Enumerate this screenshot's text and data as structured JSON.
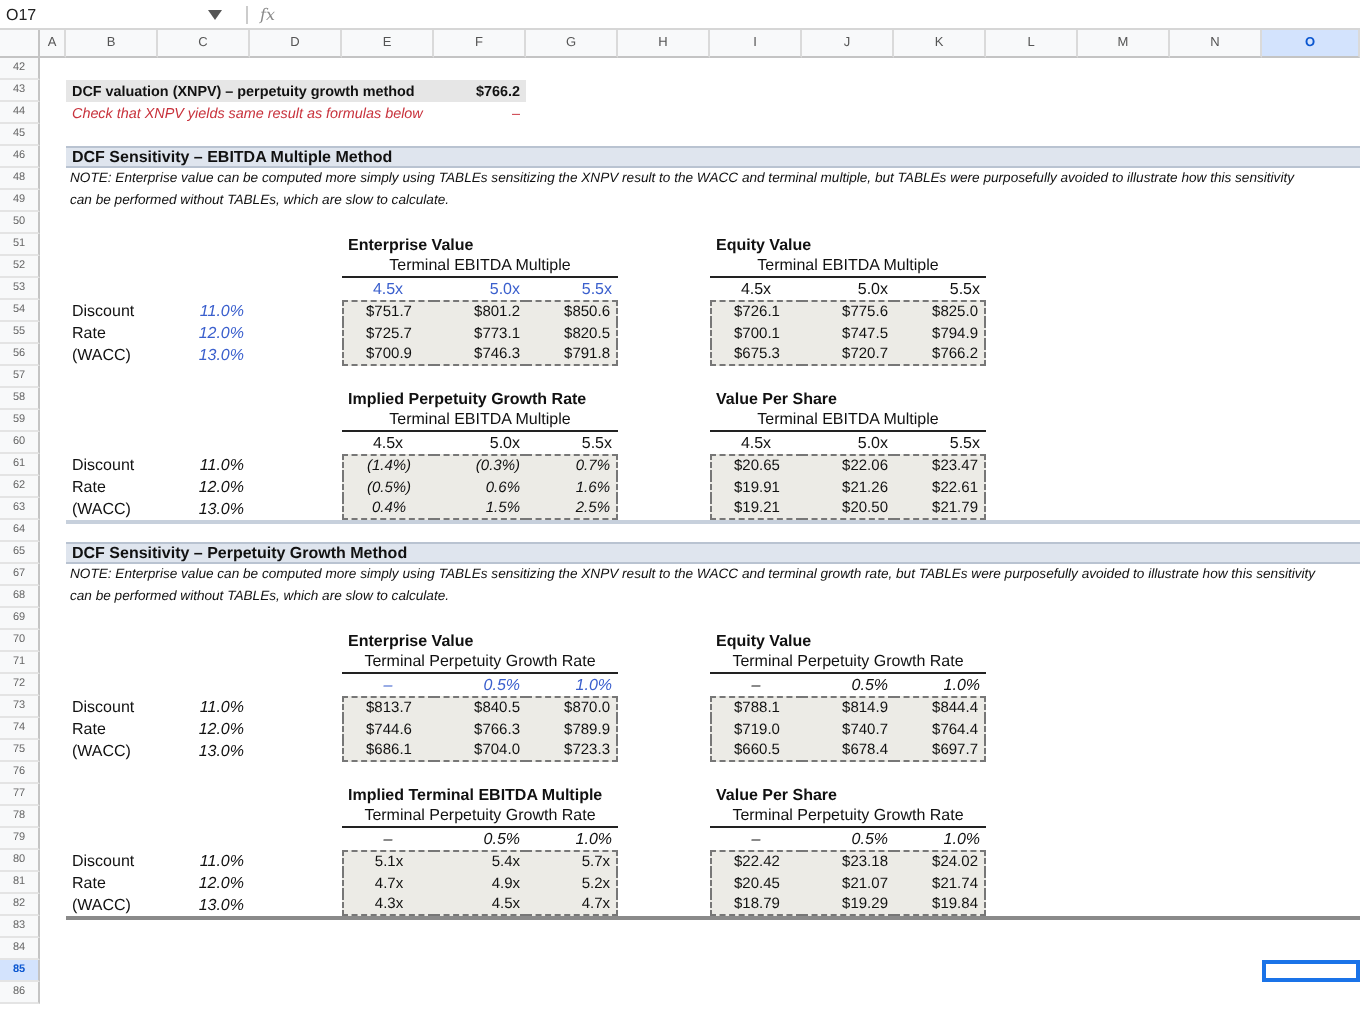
{
  "name_box": "O17",
  "formula_icon": "fx",
  "columns": [
    {
      "label": "A",
      "selected": false
    },
    {
      "label": "B",
      "selected": false
    },
    {
      "label": "C",
      "selected": false
    },
    {
      "label": "D",
      "selected": false
    },
    {
      "label": "E",
      "selected": false
    },
    {
      "label": "F",
      "selected": false
    },
    {
      "label": "G",
      "selected": false
    },
    {
      "label": "H",
      "selected": false
    },
    {
      "label": "I",
      "selected": false
    },
    {
      "label": "J",
      "selected": false
    },
    {
      "label": "K",
      "selected": false
    },
    {
      "label": "L",
      "selected": false
    },
    {
      "label": "M",
      "selected": false
    },
    {
      "label": "N",
      "selected": false
    },
    {
      "label": "O",
      "selected": true
    }
  ],
  "rows": [
    {
      "number": "42",
      "selected": false
    },
    {
      "number": "43",
      "selected": false
    },
    {
      "number": "44",
      "selected": false
    },
    {
      "number": "45",
      "selected": false
    },
    {
      "number": "46",
      "selected": false
    },
    {
      "number": "48",
      "selected": false
    },
    {
      "number": "49",
      "selected": false
    },
    {
      "number": "50",
      "selected": false
    },
    {
      "number": "51",
      "selected": false
    },
    {
      "number": "52",
      "selected": false
    },
    {
      "number": "53",
      "selected": false
    },
    {
      "number": "54",
      "selected": false
    },
    {
      "number": "55",
      "selected": false
    },
    {
      "number": "56",
      "selected": false
    },
    {
      "number": "57",
      "selected": false
    },
    {
      "number": "58",
      "selected": false
    },
    {
      "number": "59",
      "selected": false
    },
    {
      "number": "60",
      "selected": false
    },
    {
      "number": "61",
      "selected": false
    },
    {
      "number": "62",
      "selected": false
    },
    {
      "number": "63",
      "selected": false
    },
    {
      "number": "64",
      "selected": false
    },
    {
      "number": "65",
      "selected": false
    },
    {
      "number": "67",
      "selected": false
    },
    {
      "number": "68",
      "selected": false
    },
    {
      "number": "69",
      "selected": false
    },
    {
      "number": "70",
      "selected": false
    },
    {
      "number": "71",
      "selected": false
    },
    {
      "number": "72",
      "selected": false
    },
    {
      "number": "73",
      "selected": false
    },
    {
      "number": "74",
      "selected": false
    },
    {
      "number": "75",
      "selected": false
    },
    {
      "number": "76",
      "selected": false
    },
    {
      "number": "77",
      "selected": false
    },
    {
      "number": "78",
      "selected": false
    },
    {
      "number": "79",
      "selected": false
    },
    {
      "number": "80",
      "selected": false
    },
    {
      "number": "81",
      "selected": false
    },
    {
      "number": "82",
      "selected": false
    },
    {
      "number": "83",
      "selected": false
    },
    {
      "number": "84",
      "selected": false
    },
    {
      "number": "85",
      "selected": true
    },
    {
      "number": "86",
      "selected": false
    }
  ],
  "valuation": {
    "label": "DCF valuation (XNPV) – perpetuity growth method",
    "value": "$766.2",
    "check": "Check that XNPV yields same result as formulas below",
    "check_value": "–"
  },
  "sections": [
    {
      "title": "DCF Sensitivity – EBITDA Multiple Method",
      "note": [
        "NOTE:  Enterprise value can be computed more simply using TABLEs sensitizing the XNPV result to the WACC and terminal multiple, but TABLEs were purposefully avoided to illustrate how this sensitivity",
        "can be performed without TABLEs, which are slow to calculate."
      ],
      "blocks": [
        {
          "rate_labels": [
            "Discount",
            "Rate",
            "(WACC)"
          ],
          "rates": {
            "input": true,
            "values": [
              "11.0%",
              "12.0%",
              "13.0%"
            ]
          },
          "tables": [
            {
              "title": "Enterprise Value",
              "subtitle": "Terminal EBITDA Multiple",
              "columns": {
                "input": true,
                "italic": false,
                "values": [
                  "4.5x",
                  "5.0x",
                  "5.5x"
                ]
              },
              "italic": false,
              "rows": [
                [
                  "$751.7",
                  "$801.2",
                  "$850.6"
                ],
                [
                  "$725.7",
                  "$773.1",
                  "$820.5"
                ],
                [
                  "$700.9",
                  "$746.3",
                  "$791.8"
                ]
              ]
            },
            {
              "title": "Equity Value",
              "subtitle": "Terminal EBITDA Multiple",
              "columns": {
                "input": false,
                "italic": false,
                "values": [
                  "4.5x",
                  "5.0x",
                  "5.5x"
                ]
              },
              "italic": false,
              "rows": [
                [
                  "$726.1",
                  "$775.6",
                  "$825.0"
                ],
                [
                  "$700.1",
                  "$747.5",
                  "$794.9"
                ],
                [
                  "$675.3",
                  "$720.7",
                  "$766.2"
                ]
              ]
            }
          ]
        },
        {
          "rate_labels": [
            "Discount",
            "Rate",
            "(WACC)"
          ],
          "rates": {
            "input": false,
            "values": [
              "11.0%",
              "12.0%",
              "13.0%"
            ]
          },
          "tables": [
            {
              "title": "Implied Perpetuity Growth Rate",
              "subtitle": "Terminal EBITDA Multiple",
              "columns": {
                "input": false,
                "italic": false,
                "values": [
                  "4.5x",
                  "5.0x",
                  "5.5x"
                ]
              },
              "italic": true,
              "rows": [
                [
                  "(1.4%)",
                  "(0.3%)",
                  "0.7%"
                ],
                [
                  "(0.5%)",
                  "0.6%",
                  "1.6%"
                ],
                [
                  "0.4%",
                  "1.5%",
                  "2.5%"
                ]
              ]
            },
            {
              "title": "Value Per Share",
              "subtitle": "Terminal EBITDA Multiple",
              "columns": {
                "input": false,
                "italic": false,
                "values": [
                  "4.5x",
                  "5.0x",
                  "5.5x"
                ]
              },
              "italic": false,
              "rows": [
                [
                  "$20.65",
                  "$22.06",
                  "$23.47"
                ],
                [
                  "$19.91",
                  "$21.26",
                  "$22.61"
                ],
                [
                  "$19.21",
                  "$20.50",
                  "$21.79"
                ]
              ]
            }
          ]
        }
      ]
    },
    {
      "title": "DCF Sensitivity – Perpetuity Growth Method",
      "note": [
        "NOTE:  Enterprise value can be computed more simply using TABLEs sensitizing the XNPV result to the WACC and terminal growth rate, but TABLEs were purposefully avoided to illustrate how this sensitivity",
        "can be performed without TABLEs, which are slow to calculate."
      ],
      "blocks": [
        {
          "rate_labels": [
            "Discount",
            "Rate",
            "(WACC)"
          ],
          "rates": {
            "input": false,
            "values": [
              "11.0%",
              "12.0%",
              "13.0%"
            ]
          },
          "tables": [
            {
              "title": "Enterprise Value",
              "subtitle": "Terminal Perpetuity Growth Rate",
              "columns": {
                "input": true,
                "italic": true,
                "values": [
                  "–",
                  "0.5%",
                  "1.0%"
                ]
              },
              "italic": false,
              "rows": [
                [
                  "$813.7",
                  "$840.5",
                  "$870.0"
                ],
                [
                  "$744.6",
                  "$766.3",
                  "$789.9"
                ],
                [
                  "$686.1",
                  "$704.0",
                  "$723.3"
                ]
              ]
            },
            {
              "title": "Equity Value",
              "subtitle": "Terminal Perpetuity Growth Rate",
              "columns": {
                "input": false,
                "italic": true,
                "values": [
                  "–",
                  "0.5%",
                  "1.0%"
                ]
              },
              "italic": false,
              "rows": [
                [
                  "$788.1",
                  "$814.9",
                  "$844.4"
                ],
                [
                  "$719.0",
                  "$740.7",
                  "$764.4"
                ],
                [
                  "$660.5",
                  "$678.4",
                  "$697.7"
                ]
              ]
            }
          ]
        },
        {
          "rate_labels": [
            "Discount",
            "Rate",
            "(WACC)"
          ],
          "rates": {
            "input": false,
            "values": [
              "11.0%",
              "12.0%",
              "13.0%"
            ]
          },
          "tables": [
            {
              "title": "Implied Terminal EBITDA Multiple",
              "subtitle": "Terminal Perpetuity Growth Rate",
              "columns": {
                "input": false,
                "italic": true,
                "values": [
                  "–",
                  "0.5%",
                  "1.0%"
                ]
              },
              "italic": false,
              "rows": [
                [
                  "5.1x",
                  "5.4x",
                  "5.7x"
                ],
                [
                  "4.7x",
                  "4.9x",
                  "5.2x"
                ],
                [
                  "4.3x",
                  "4.5x",
                  "4.7x"
                ]
              ]
            },
            {
              "title": "Value Per Share",
              "subtitle": "Terminal Perpetuity Growth Rate",
              "columns": {
                "input": false,
                "italic": true,
                "values": [
                  "–",
                  "0.5%",
                  "1.0%"
                ]
              },
              "italic": false,
              "rows": [
                [
                  "$22.42",
                  "$23.18",
                  "$24.02"
                ],
                [
                  "$20.45",
                  "$21.07",
                  "$21.74"
                ],
                [
                  "$18.79",
                  "$19.29",
                  "$19.84"
                ]
              ]
            }
          ]
        }
      ]
    }
  ]
}
